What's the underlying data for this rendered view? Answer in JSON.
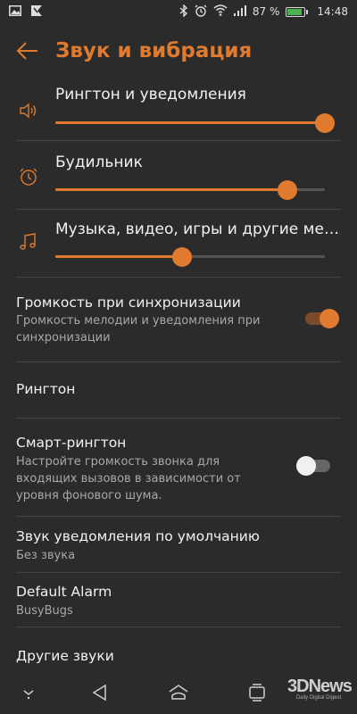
{
  "status_bar": {
    "battery_percent": "87 %",
    "battery_level": 0.87,
    "time": "14:48",
    "icons": [
      "image-icon",
      "flag-icon",
      "bluetooth-icon",
      "alarm-icon",
      "wifi-icon",
      "signal-icon",
      "battery-icon"
    ]
  },
  "header": {
    "title": "Звук и вибрация"
  },
  "volumes": [
    {
      "label": "Рингтон и уведомления",
      "level": 1.0,
      "icon": "speaker-icon"
    },
    {
      "label": "Будильник",
      "level": 0.86,
      "icon": "alarm-clock-icon"
    },
    {
      "label": "Музыка, видео, игры и другие медиа…",
      "level": 0.47,
      "icon": "music-note-icon"
    }
  ],
  "settings": {
    "sync_volume": {
      "title": "Громкость при синхронизации",
      "subtitle": "Громкость мелодии и уведомления при синхронизации",
      "enabled": true
    },
    "ringtone": {
      "title": "Рингтон"
    },
    "smart_ringtone": {
      "title": "Смарт-рингтон",
      "subtitle": "Настройте громкость звонка для входящих вызовов в зависимости от уровня фонового шума.",
      "enabled": false
    },
    "default_notification": {
      "title": "Звук уведомления по умолчанию",
      "value": "Без звука"
    },
    "default_alarm": {
      "title": "Default Alarm",
      "value": "BusyBugs"
    },
    "other_sounds": {
      "title": "Другие звуки"
    }
  },
  "watermark": {
    "logo": "3DNews",
    "tagline": "Daily Digital Digest"
  },
  "colors": {
    "accent": "#e07a2e",
    "background": "#2b2b2b",
    "secondary_text": "#a8a8a8"
  }
}
